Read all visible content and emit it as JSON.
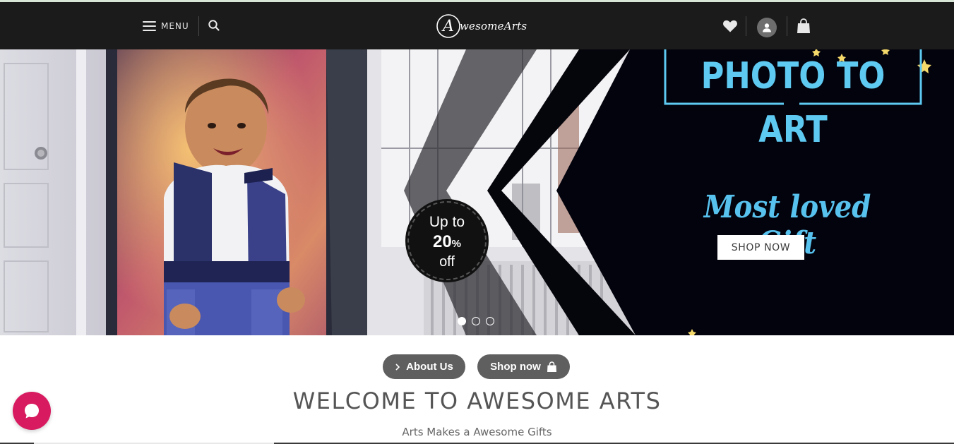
{
  "header": {
    "menu_label": "MENU",
    "logo_text": "wesomeArts",
    "logo_letter": "A"
  },
  "hero": {
    "promo": {
      "line1": "Up to",
      "percent": "20",
      "percent_sign": "%",
      "line3": "off"
    },
    "headline": "PHOTO TO ART",
    "tagline": "Most loved Gift",
    "cta_label": "SHOP NOW",
    "slides_total": 3,
    "active_slide": 1
  },
  "actions": {
    "about_label": "About Us",
    "shop_label": "Shop now"
  },
  "welcome": {
    "title": "WELCOME TO AWESOME ARTS",
    "subtitle": "Arts Makes a Awesome Gifts"
  },
  "colors": {
    "navbar_bg": "#1b1b1b",
    "accent_blue": "#5ec9f1",
    "pill_bg": "#5f5f5f",
    "chat_bg": "#d81b60"
  },
  "icons": {
    "menu": "hamburger-icon",
    "search": "search-icon",
    "wishlist": "heart-icon",
    "account": "user-icon",
    "cart": "shopping-bag-icon",
    "about_chevron": "chevron-right-icon",
    "shop_bag": "shopping-bag-icon",
    "chat": "chat-icon"
  }
}
